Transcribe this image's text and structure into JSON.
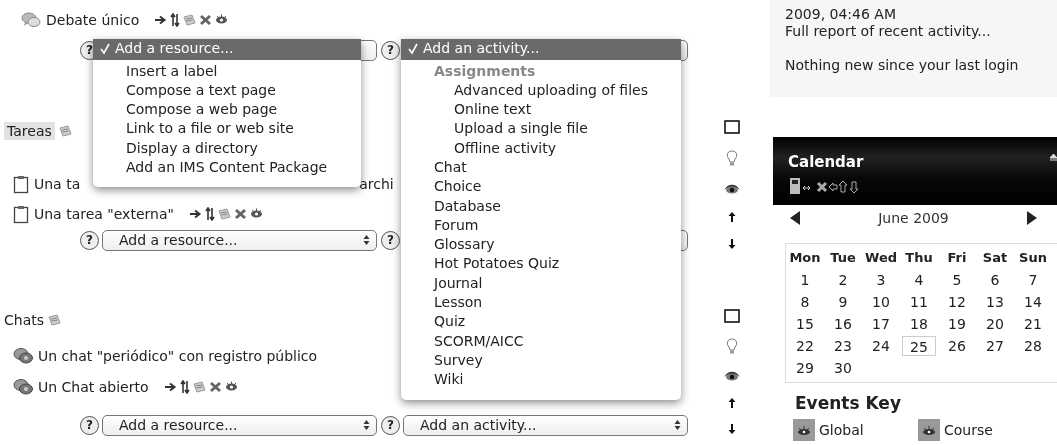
{
  "sections": [
    {
      "items": [
        {
          "kind": "forum",
          "parts": [
            "Debate único"
          ],
          "tools": true
        }
      ],
      "adders": [
        {
          "kind": "resource",
          "help": "?",
          "open": true,
          "menu": [
            {
              "label": "Add a resource...",
              "selected": true
            },
            {
              "label": "Insert a label",
              "selected": false
            },
            {
              "label": "Compose a text page",
              "selected": false
            },
            {
              "label": "Compose a web page",
              "selected": false
            },
            {
              "label": "Link to a file or web site",
              "selected": false
            },
            {
              "label": "Display a directory",
              "selected": false
            },
            {
              "label": "Add an IMS Content Package",
              "selected": false
            }
          ]
        },
        {
          "kind": "activity",
          "help": "?",
          "open": true,
          "menu": [
            {
              "label": "Add an activity...",
              "selected": true
            },
            {
              "label": "Assignments",
              "kind": "group",
              "children": [
                {
                  "label": "Advanced uploading of files",
                  "selected": false
                },
                {
                  "label": "Online text",
                  "selected": false
                },
                {
                  "label": "Upload a single file",
                  "selected": false
                },
                {
                  "label": "Offline activity",
                  "selected": false
                }
              ]
            },
            {
              "label": "Chat",
              "selected": false
            },
            {
              "label": "Choice",
              "selected": false
            },
            {
              "label": "Database",
              "selected": false
            },
            {
              "label": "Forum",
              "selected": false
            },
            {
              "label": "Glossary",
              "selected": false
            },
            {
              "label": "Hot Potatoes Quiz",
              "selected": false
            },
            {
              "label": "Journal",
              "selected": false
            },
            {
              "label": "Lesson",
              "selected": false
            },
            {
              "label": "Quiz",
              "selected": false
            },
            {
              "label": "SCORM/AICC",
              "selected": false
            },
            {
              "label": "Survey",
              "selected": false
            },
            {
              "label": "Wiki",
              "selected": false
            }
          ]
        }
      ]
    },
    {
      "heading": "Tareas",
      "highlighted": true,
      "side_tools": true,
      "items": [
        {
          "kind": "assignment",
          "parts": [
            "Una ta",
            "archi"
          ],
          "tools": false
        },
        {
          "kind": "assignment",
          "parts": [
            "Una tarea \"externa\""
          ],
          "tools": true
        }
      ],
      "adders": [
        {
          "kind": "resource",
          "help": "?",
          "open": false,
          "label": "Add a resource..."
        },
        {
          "kind": "activity",
          "help": "?",
          "open": false
        }
      ]
    },
    {
      "heading": "Chats",
      "highlighted": false,
      "side_tools": true,
      "items": [
        {
          "kind": "chat",
          "parts": [
            "Un chat \"periódico\" con registro público"
          ],
          "tools": false
        },
        {
          "kind": "chat",
          "parts": [
            "Un Chat abierto"
          ],
          "tools": true
        }
      ],
      "adders": [
        {
          "kind": "resource",
          "help": "?",
          "open": false,
          "label": "Add a resource..."
        },
        {
          "kind": "activity",
          "help": "?",
          "open": false,
          "label": "Add an activity..."
        }
      ]
    }
  ],
  "recent": {
    "date": "2009, 04:46 AM",
    "link": "Full report of recent activity...",
    "note": "Nothing new since your last login"
  },
  "calendar": {
    "title": "Calendar",
    "month": "June 2009",
    "weekdays": [
      "Mon",
      "Tue",
      "Wed",
      "Thu",
      "Fri",
      "Sat",
      "Sun"
    ],
    "weeks": [
      [
        {
          "day": "1",
          "today": false
        },
        {
          "day": "2",
          "today": false
        },
        {
          "day": "3",
          "today": false
        },
        {
          "day": "4",
          "today": false
        },
        {
          "day": "5",
          "today": false
        },
        {
          "day": "6",
          "today": false
        },
        {
          "day": "7",
          "today": false
        }
      ],
      [
        {
          "day": "8",
          "today": false
        },
        {
          "day": "9",
          "today": false
        },
        {
          "day": "10",
          "today": false
        },
        {
          "day": "11",
          "today": false
        },
        {
          "day": "12",
          "today": false
        },
        {
          "day": "13",
          "today": false
        },
        {
          "day": "14",
          "today": false
        }
      ],
      [
        {
          "day": "15",
          "today": false
        },
        {
          "day": "16",
          "today": false
        },
        {
          "day": "17",
          "today": false
        },
        {
          "day": "18",
          "today": false
        },
        {
          "day": "19",
          "today": false
        },
        {
          "day": "20",
          "today": false
        },
        {
          "day": "21",
          "today": false
        }
      ],
      [
        {
          "day": "22",
          "today": false
        },
        {
          "day": "23",
          "today": false
        },
        {
          "day": "24",
          "today": false
        },
        {
          "day": "25",
          "today": true
        },
        {
          "day": "26",
          "today": false
        },
        {
          "day": "27",
          "today": false
        },
        {
          "day": "28",
          "today": false
        }
      ],
      [
        {
          "day": "29",
          "today": false
        },
        {
          "day": "30",
          "today": false
        }
      ]
    ],
    "events_key": {
      "title": "Events Key",
      "items": [
        "Global",
        "Course"
      ]
    }
  }
}
